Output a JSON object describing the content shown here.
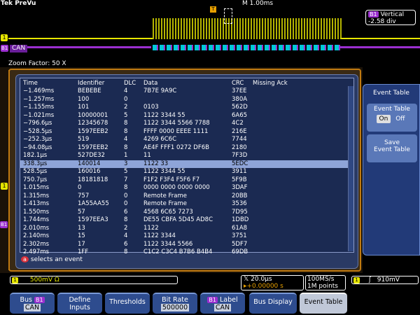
{
  "header": {
    "brand": "Tek",
    "mode": "PreVu",
    "timebase": "M 1.00ms",
    "trigger_marker": "T"
  },
  "overview": {
    "ch1_marker": "1",
    "bus_marker": "B1",
    "bus_name": "CAN",
    "vertical_label": "Vertical",
    "vertical_value": "-2.58 div"
  },
  "zoom": {
    "label": "Zoom Factor: 50 X"
  },
  "side_markers": {
    "ch1": "1",
    "b1": "B1"
  },
  "event_table": {
    "columns": [
      "Time",
      "Identifier",
      "DLC",
      "Data",
      "CRC",
      "Missing Ack"
    ],
    "selected_index": 10,
    "rows": [
      [
        "−1.469ms",
        "BEBEBE",
        "4",
        "7B7E 9A9C",
        "37EE",
        ""
      ],
      [
        "−1.257ms",
        "100",
        "0",
        "",
        "380A",
        ""
      ],
      [
        "−1.155ms",
        "101",
        "2",
        "0103",
        "562D",
        ""
      ],
      [
        "−1.021ms",
        "10000001",
        "5",
        "1122 3344 55",
        "6A65",
        ""
      ],
      [
        "−796.6µs",
        "12345678",
        "8",
        "1122 3344 5566 7788",
        "4C2",
        ""
      ],
      [
        "−528.5µs",
        "1597EEB2",
        "8",
        "FFFF 0000 EEEE 1111",
        "216E",
        ""
      ],
      [
        "−252.3µs",
        "519",
        "4",
        "4269 6C6C",
        "7744",
        ""
      ],
      [
        "−94.08µs",
        "1597EEB2",
        "8",
        "AE4F FFF1 0272 DF6B",
        "2180",
        ""
      ],
      [
        "182.1µs",
        "527DE32",
        "1",
        "11",
        "7F3D",
        ""
      ],
      [
        "338.3µs",
        "140014",
        "3",
        "1122 33",
        "5EDC",
        ""
      ],
      [
        "528.5µs",
        "160016",
        "5",
        "1122 3344 55",
        "3911",
        ""
      ],
      [
        "750.7µs",
        "18181818",
        "7",
        "F1F2 F3F4 F5F6 F7",
        "5F9B",
        ""
      ],
      [
        "1.015ms",
        "0",
        "8",
        "0000 0000 0000 0000",
        "3DAF",
        ""
      ],
      [
        "1.315ms",
        "757",
        "0",
        "Remote Frame",
        "20BB",
        ""
      ],
      [
        "1.413ms",
        "1A55AA55",
        "0",
        "Remote Frame",
        "3536",
        ""
      ],
      [
        "1.550ms",
        "57",
        "6",
        "4568 6C65 7273",
        "7D95",
        ""
      ],
      [
        "1.744ms",
        "1597EEA3",
        "8",
        "DE55 CBFA 5D45 AD8C",
        "1DBD",
        ""
      ],
      [
        "2.010ms",
        "13",
        "2",
        "1122",
        "61A8",
        ""
      ],
      [
        "2.140ms",
        "15",
        "4",
        "1122 3344",
        "3751",
        ""
      ],
      [
        "2.302ms",
        "17",
        "6",
        "1122 3344 5566",
        "5DF7",
        ""
      ],
      [
        "2.497ms",
        "1FF",
        "8",
        "C1C2 C3C4 B7B6 B4B4",
        "69DB",
        ""
      ]
    ],
    "hint_badge": "a",
    "hint": "selects an event"
  },
  "side_menu": {
    "title": "Event Table",
    "toggle_label": "Event Table",
    "on": "On",
    "off": "Off",
    "save_label_1": "Save",
    "save_label_2": "Event Table"
  },
  "status": {
    "ch1_badge": "1",
    "ch1_scale": "500mV Ω",
    "horiz_scale": "20.0µs",
    "trig_pos": "▸+0.00000 s",
    "trig_pos_badge": "T",
    "sample_rate": "100MS/s",
    "record_len": "1M points",
    "trig_ch": "1",
    "trig_slope": "ʃ",
    "trig_level": "910mV"
  },
  "bottom_buttons": {
    "bus_label": "Bus",
    "bus_badge": "B1",
    "bus_value": "CAN",
    "define_inputs": [
      "Define",
      "Inputs"
    ],
    "thresholds": "Thresholds",
    "bit_rate_label": "Bit Rate",
    "bit_rate_value": "500000",
    "label_badge": "B1",
    "label_label": "Label",
    "label_value": "CAN",
    "bus_display": "Bus Display",
    "event_table": "Event Table"
  },
  "colors": {
    "ch1": "#e6e600",
    "bus": "#9b2fd0",
    "accent_orange": "#e8a000",
    "panel_blue": "#2a3a64",
    "selected_row": "#8ea4d8"
  }
}
